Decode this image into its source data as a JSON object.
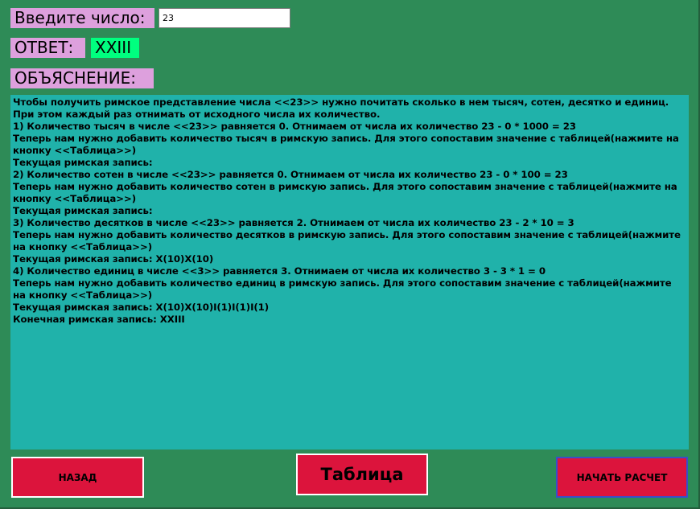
{
  "form": {
    "input_label": "Введите число:",
    "input_value": "23",
    "answer_label": "ОТВЕТ:",
    "answer_value": "XXIII",
    "explanation_label": "ОБЪЯСНЕНИЕ:"
  },
  "explanation": {
    "lines": [
      "Чтобы получить римское представление числа <<23>> нужно почитать сколько в нем тысяч, сотен, десятко и единиц.",
      "При этом каждый раз отнимать от исходного числа их количество.",
      "1) Количество тысяч в числе <<23>> равняется 0. Отнимаем от числа их количество 23 - 0 * 1000 = 23",
      "Теперь нам нужно добавить количество тысяч в римскую запись. Для этого сопоставим значение с таблицей(нажмите на кнопку <<Таблица>>)",
      "Текущая римская запись:",
      "2) Количество сотен в числе <<23>> равняется 0. Отнимаем от числа их количество 23 - 0 * 100 = 23",
      "Теперь нам нужно добавить количество сотен в римскую запись. Для этого сопоставим значение с таблицей(нажмите на кнопку <<Таблица>>)",
      "Текущая римская запись:",
      "3) Количество десятков в числе <<23>> равняется 2. Отнимаем от числа их количество 23 - 2 * 10 = 3",
      "Теперь нам нужно добавить количество десятков в римскую запись. Для этого сопоставим значение с таблицей(нажмите на кнопку <<Таблица>>)",
      "Текущая римская запись: X(10)X(10)",
      "4) Количество единиц в числе <<3>> равняется 3. Отнимаем от числа их количество 3 - 3 * 1 = 0",
      "Теперь нам нужно добавить количество единиц в римскую запись. Для этого сопоставим значение с таблицей(нажмите на кнопку <<Таблица>>)",
      "Текущая римская запись: X(10)X(10)I(1)I(1)I(1)",
      "Конечная римская запись: XXIII"
    ]
  },
  "buttons": {
    "back_label": "НАЗАД",
    "table_label": "Таблица",
    "start_label": "НАЧАТЬ РАСЧЕТ"
  },
  "colors": {
    "background": "#2e8b57",
    "label_bg": "#dda0dd",
    "answer_bg": "#00ff7f",
    "explanation_bg": "#20b2aa",
    "button_bg": "#dc143c"
  }
}
